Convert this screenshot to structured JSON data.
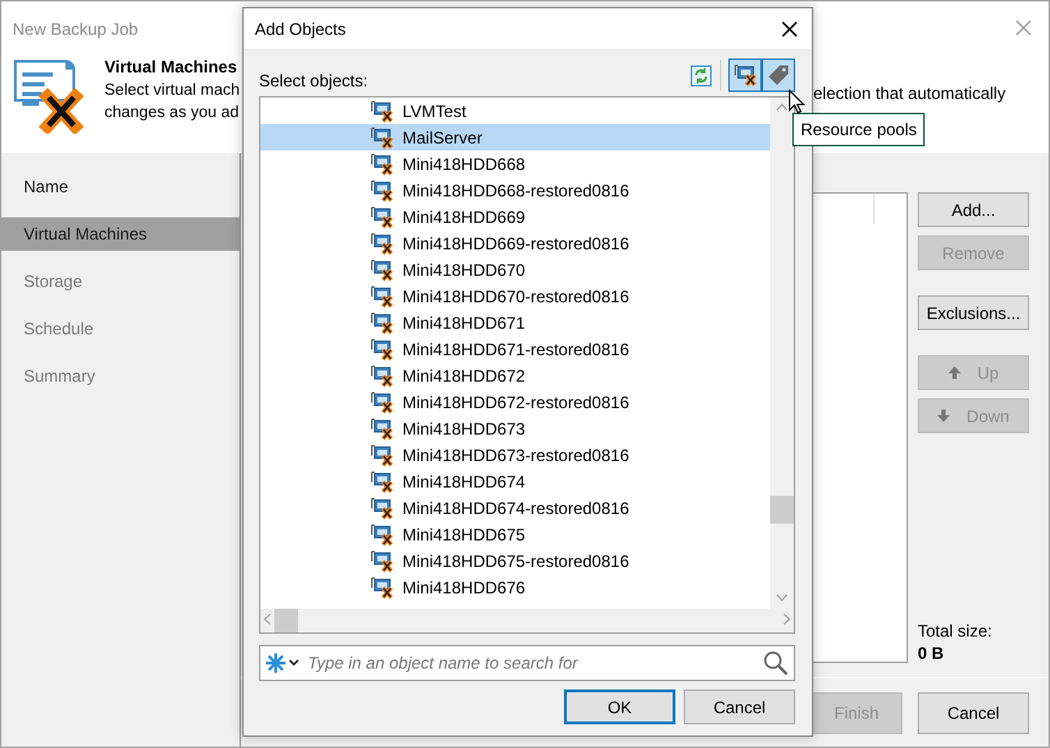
{
  "window": {
    "title": "New Backup Job"
  },
  "header": {
    "title": "Virtual Machines",
    "description_lines": [
      "Select virtual mach",
      "changes as you ad"
    ],
    "description_right": "election that automatically"
  },
  "steps": [
    {
      "label": "Name",
      "selected": false,
      "disabled": false
    },
    {
      "label": "Virtual Machines",
      "selected": true,
      "disabled": false
    },
    {
      "label": "Storage",
      "selected": false,
      "disabled": true
    },
    {
      "label": "Schedule",
      "selected": false,
      "disabled": true
    },
    {
      "label": "Summary",
      "selected": false,
      "disabled": true
    }
  ],
  "side_button_groups": [
    [
      {
        "label": "Add...",
        "disabled": false,
        "kind": "plain"
      },
      {
        "label": "Remove",
        "disabled": true,
        "kind": "plain"
      }
    ],
    [
      {
        "label": "Exclusions...",
        "disabled": false,
        "kind": "plain"
      }
    ],
    [
      {
        "label": "Up",
        "disabled": true,
        "kind": "up"
      },
      {
        "label": "Down",
        "disabled": true,
        "kind": "down"
      }
    ]
  ],
  "total_size": {
    "label": "Total size:",
    "value": "0 B"
  },
  "footer_buttons": [
    {
      "label": "Finish",
      "disabled": true
    },
    {
      "label": "Cancel",
      "disabled": false
    }
  ],
  "dialog": {
    "title": "Add Objects",
    "select_label": "Select objects:",
    "view_toggles": [
      {
        "kind": "vms",
        "selected": true
      },
      {
        "kind": "tags",
        "selected": true
      }
    ],
    "tooltip": "Resource pools",
    "items": [
      {
        "label": "LVMTest",
        "selected": false
      },
      {
        "label": "MailServer",
        "selected": true
      },
      {
        "label": "Mini418HDD668",
        "selected": false
      },
      {
        "label": "Mini418HDD668-restored0816",
        "selected": false
      },
      {
        "label": "Mini418HDD669",
        "selected": false
      },
      {
        "label": "Mini418HDD669-restored0816",
        "selected": false
      },
      {
        "label": "Mini418HDD670",
        "selected": false
      },
      {
        "label": "Mini418HDD670-restored0816",
        "selected": false
      },
      {
        "label": "Mini418HDD671",
        "selected": false
      },
      {
        "label": "Mini418HDD671-restored0816",
        "selected": false
      },
      {
        "label": "Mini418HDD672",
        "selected": false
      },
      {
        "label": "Mini418HDD672-restored0816",
        "selected": false
      },
      {
        "label": "Mini418HDD673",
        "selected": false
      },
      {
        "label": "Mini418HDD673-restored0816",
        "selected": false
      },
      {
        "label": "Mini418HDD674",
        "selected": false
      },
      {
        "label": "Mini418HDD674-restored0816",
        "selected": false
      },
      {
        "label": "Mini418HDD675",
        "selected": false
      },
      {
        "label": "Mini418HDD675-restored0816",
        "selected": false
      },
      {
        "label": "Mini418HDD676",
        "selected": false
      }
    ],
    "search": {
      "placeholder": "Type in an object name to search for"
    },
    "buttons": [
      {
        "label": "OK",
        "default": true
      },
      {
        "label": "Cancel",
        "default": false
      }
    ]
  }
}
